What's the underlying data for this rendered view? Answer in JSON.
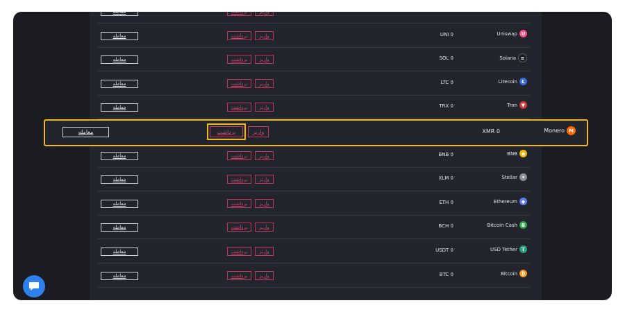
{
  "labels": {
    "trade": "معامله",
    "withdraw": "برداشت",
    "deposit": "واریز"
  },
  "rows": [
    {
      "coin": "Uniswap",
      "balance": "UNI 0",
      "icon": "uniswap-icon",
      "color": "#ff4d7d",
      "glyph": "🦄"
    },
    {
      "coin": "Solana",
      "balance": "SOL 0",
      "icon": "solana-icon",
      "color": "#1b1c21",
      "glyph": "≡"
    },
    {
      "coin": "Litecoin",
      "balance": "LTC 0",
      "icon": "litecoin-icon",
      "color": "#3a6bd8",
      "glyph": "Ł"
    },
    {
      "coin": "Tron",
      "balance": "TRX 0",
      "icon": "tron-icon",
      "color": "#d23a3a",
      "glyph": "▼"
    },
    {
      "coin": "BNB",
      "balance": "BNB 0",
      "icon": "bnb-icon",
      "color": "#f0b90b",
      "glyph": "◆"
    },
    {
      "coin": "Stellar",
      "balance": "XLM 0",
      "icon": "stellar-icon",
      "color": "#8a8f99",
      "glyph": "✦"
    },
    {
      "coin": "Ethereum",
      "balance": "ETH 0",
      "icon": "ethereum-icon",
      "color": "#627eea",
      "glyph": "◆"
    },
    {
      "coin": "Bitcoin Cash",
      "balance": "BCH 0",
      "icon": "bitcoin-cash-icon",
      "color": "#2fa84f",
      "glyph": "Ƀ"
    },
    {
      "coin": "USD Tether",
      "balance": "USDT 0",
      "icon": "tether-icon",
      "color": "#26a17b",
      "glyph": "T"
    },
    {
      "coin": "Bitcoin",
      "balance": "BTC 0",
      "icon": "bitcoin-icon",
      "color": "#f7931a",
      "glyph": "₿"
    }
  ],
  "highlighted": {
    "coin": "Monero",
    "balance": "XMR 0",
    "icon": "monero-icon",
    "color": "#ff6600",
    "glyph": "M"
  }
}
